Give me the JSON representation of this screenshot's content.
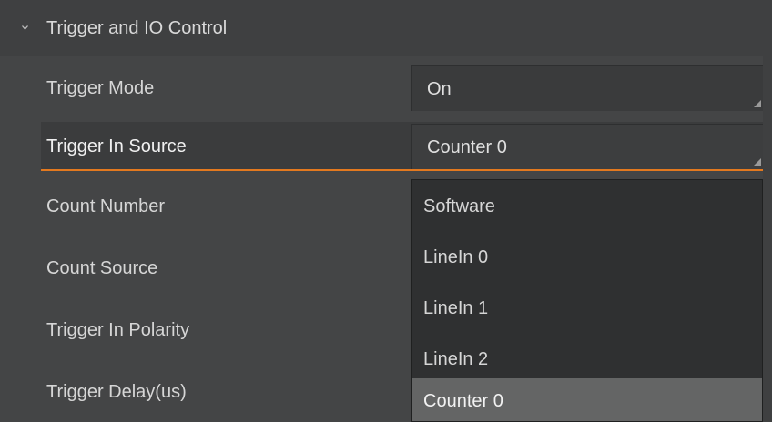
{
  "section": {
    "title": "Trigger and IO Control",
    "expanded": true,
    "icon": "chevron-down-icon"
  },
  "rows": [
    {
      "label": "Trigger Mode",
      "value": "On"
    },
    {
      "label": "Trigger In Source",
      "value": "Counter 0",
      "selected": true
    },
    {
      "label": "Count Number"
    },
    {
      "label": "Count Source"
    },
    {
      "label": "Trigger In Polarity"
    },
    {
      "label": "Trigger Delay(us)"
    }
  ],
  "dropdown": {
    "options": [
      "Software",
      "LineIn 0",
      "LineIn 1",
      "LineIn 2",
      "Counter 0"
    ],
    "selected_value": "Counter 0"
  },
  "colors": {
    "background": "#444546",
    "selection_underline": "#e3791f",
    "dropdown_bg": "#2f3031",
    "dropdown_highlight": "#646565"
  }
}
